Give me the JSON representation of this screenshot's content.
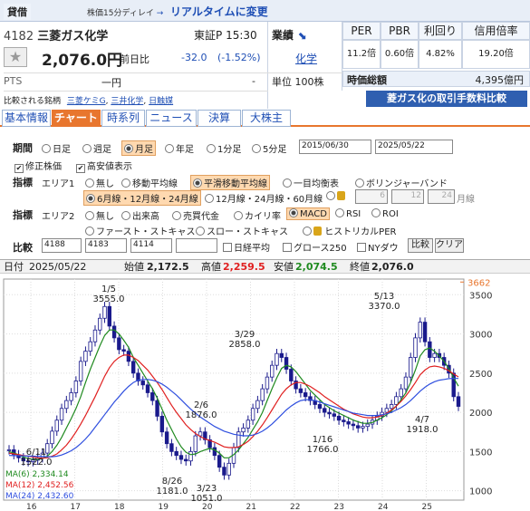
{
  "header": {
    "badge": "貸借",
    "delay": "株価15分ディレイ",
    "arrow": "→",
    "realtime": "リアルタイムに変更"
  },
  "quote": {
    "code": "4182",
    "name": "三菱ガス化学",
    "market": "東証P",
    "time": "15:30",
    "price": "2,076.0円",
    "prev_label": "前日比",
    "change": "-32.0",
    "change_pct": "(-1.52%)",
    "pts_label": "PTS",
    "pts_value": "一円",
    "pts_change": "-",
    "compare_label": "比較される銘柄",
    "compare_links": [
      "三菱ケミG",
      "三井化学",
      "日触媒"
    ]
  },
  "sector": {
    "label": "業績",
    "value": "化学",
    "unit": "単位 100株"
  },
  "stats": {
    "per_label": "PER",
    "pbr_label": "PBR",
    "yield_label": "利回り",
    "margin_label": "信用倍率",
    "per": "11.2倍",
    "pbr": "0.60倍",
    "yield": "4.82%",
    "margin": "19.20倍",
    "mcap_label": "時価総額",
    "mcap": "4,395億円",
    "promo": "菱ガス化の取引手数料比較"
  },
  "tabs": [
    "基本情報",
    "チャート",
    "時系列",
    "ニュース",
    "決算",
    "大株主"
  ],
  "controls": {
    "period_label": "期間",
    "periods": [
      "日足",
      "週足",
      "月足",
      "年足",
      "1分足",
      "5分足"
    ],
    "date_from": "2015/06/30",
    "date_to": "2025/05/22",
    "adjust": "修正株価",
    "highlow": "高安値表示",
    "ind_label": "指標",
    "area1": "エリア1",
    "area1_opts": [
      "無し",
      "移動平均線",
      "平滑移動平均線",
      "一目均衡表",
      "ボリンジャーバンド"
    ],
    "ma_opts": [
      "6月線・12月線・24月線",
      "12月線・24月線・60月線"
    ],
    "ma_inputs": [
      "6",
      "12",
      "24"
    ],
    "ma_unit": "月線",
    "area2": "エリア2",
    "area2_opts": [
      "無し",
      "出来高",
      "売買代金",
      "カイリ率",
      "MACD",
      "RSI",
      "ROI",
      "ファースト・ストキャス",
      "スロー・ストキャス",
      "ヒストリカルPER"
    ],
    "cmp_label": "比較",
    "cmp_inputs": [
      "4188",
      "4183",
      "4114",
      ""
    ],
    "cmp_opts": [
      "日経平均",
      "グロース250",
      "NYダウ"
    ],
    "cmp_btn": "比較",
    "clear_btn": "クリア"
  },
  "ohlc": {
    "date_label": "日付",
    "date": "2025/05/22",
    "open_label": "始値",
    "open": "2,172.5",
    "high_label": "高値",
    "high": "2,259.5",
    "low_label": "安値",
    "low": "2,074.5",
    "close_label": "終値",
    "close": "2,076.0"
  },
  "chart_data": {
    "type": "line",
    "y_ticks": [
      1000,
      1500,
      2000,
      2500,
      3000,
      3500
    ],
    "ylim": [
      880,
      3700
    ],
    "high_marker": "3662",
    "x_labels": [
      "16",
      "17",
      "18",
      "19",
      "20",
      "21",
      "22",
      "23",
      "24",
      "25"
    ],
    "ma_legend": [
      {
        "label": "MA(6)",
        "value": "2,334.14",
        "color": "#1f8a1f"
      },
      {
        "label": "MA(12)",
        "value": "2,452.56",
        "color": "#e02020"
      },
      {
        "label": "MA(24)",
        "value": "2,432.60",
        "color": "#2f4fdf"
      }
    ],
    "annotations": [
      {
        "date": "6/11",
        "value": "1522.0"
      },
      {
        "date": "1/5",
        "value": "3555.0"
      },
      {
        "date": "8/26",
        "value": "1181.0"
      },
      {
        "date": "2/6",
        "value": "1876.0"
      },
      {
        "date": "3/23",
        "value": "1051.0"
      },
      {
        "date": "3/29",
        "value": "2858.0"
      },
      {
        "date": "1/16",
        "value": "1766.0"
      },
      {
        "date": "5/13",
        "value": "3370.0"
      },
      {
        "date": "4/7",
        "value": "1918.0"
      }
    ],
    "closes": [
      1522,
      1460,
      1420,
      1380,
      1370,
      1390,
      1420,
      1480,
      1600,
      1760,
      1900,
      2050,
      2150,
      2250,
      2400,
      2650,
      2780,
      2900,
      3050,
      3200,
      3350,
      3100,
      2950,
      2800,
      2780,
      2650,
      2500,
      2400,
      2350,
      2250,
      2150,
      1950,
      1750,
      1600,
      1500,
      1450,
      1400,
      1380,
      1500,
      1700,
      1750,
      1650,
      1550,
      1450,
      1300,
      1200,
      1350,
      1550,
      1750,
      1800,
      1900,
      2050,
      2150,
      2300,
      2450,
      2600,
      2750,
      2700,
      2550,
      2400,
      2300,
      2250,
      2200,
      2150,
      2100,
      2050,
      2000,
      1980,
      1950,
      1900,
      1880,
      1850,
      1830,
      1800,
      1820,
      1850,
      1900,
      1950,
      2000,
      2050,
      2100,
      2200,
      2300,
      2450,
      2700,
      2950,
      3150,
      2900,
      2700,
      2750,
      2700,
      2600,
      2500,
      2200,
      2076
    ],
    "ma6": [
      1500,
      1480,
      1460,
      1430,
      1410,
      1400,
      1400,
      1410,
      1440,
      1500,
      1580,
      1680,
      1800,
      1920,
      2050,
      2200,
      2380,
      2550,
      2700,
      2850,
      2980,
      3050,
      3050,
      3000,
      2920,
      2830,
      2700,
      2600,
      2500,
      2400,
      2300,
      2180,
      2040,
      1900,
      1780,
      1660,
      1560,
      1490,
      1460,
      1470,
      1500,
      1520,
      1540,
      1520,
      1480,
      1420,
      1420,
      1460,
      1520,
      1600,
      1680,
      1780,
      1880,
      2000,
      2150,
      2300,
      2440,
      2560,
      2600,
      2580,
      2520,
      2440,
      2360,
      2280,
      2220,
      2160,
      2100,
      2060,
      2020,
      1990,
      1960,
      1930,
      1900,
      1880,
      1860,
      1860,
      1870,
      1900,
      1930,
      1970,
      2020,
      2080,
      2160,
      2250,
      2380,
      2540,
      2720,
      2800,
      2820,
      2780,
      2720,
      2650,
      2560,
      2440,
      2334
    ],
    "ma12": [
      1480,
      1470,
      1460,
      1450,
      1440,
      1430,
      1420,
      1415,
      1420,
      1440,
      1470,
      1520,
      1580,
      1660,
      1750,
      1850,
      1960,
      2080,
      2200,
      2330,
      2460,
      2570,
      2650,
      2700,
      2730,
      2730,
      2700,
      2660,
      2600,
      2540,
      2460,
      2380,
      2290,
      2190,
      2090,
      2000,
      1920,
      1840,
      1780,
      1730,
      1690,
      1660,
      1640,
      1620,
      1590,
      1560,
      1550,
      1550,
      1560,
      1590,
      1630,
      1690,
      1760,
      1840,
      1930,
      2030,
      2130,
      2230,
      2300,
      2350,
      2380,
      2380,
      2360,
      2330,
      2290,
      2250,
      2200,
      2160,
      2120,
      2080,
      2040,
      2010,
      1980,
      1960,
      1940,
      1930,
      1930,
      1940,
      1960,
      1990,
      2030,
      2080,
      2140,
      2210,
      2290,
      2380,
      2480,
      2540,
      2580,
      2590,
      2580,
      2560,
      2530,
      2490,
      2452
    ],
    "ma24": [
      1450,
      1448,
      1446,
      1444,
      1442,
      1440,
      1438,
      1436,
      1434,
      1434,
      1440,
      1455,
      1480,
      1510,
      1550,
      1600,
      1660,
      1730,
      1810,
      1890,
      1970,
      2050,
      2130,
      2200,
      2270,
      2330,
      2380,
      2410,
      2420,
      2420,
      2410,
      2390,
      2360,
      2320,
      2270,
      2220,
      2160,
      2100,
      2040,
      1990,
      1940,
      1900,
      1860,
      1820,
      1790,
      1760,
      1740,
      1720,
      1710,
      1700,
      1700,
      1710,
      1730,
      1760,
      1800,
      1850,
      1910,
      1970,
      2030,
      2080,
      2120,
      2150,
      2160,
      2160,
      2150,
      2130,
      2110,
      2090,
      2070,
      2050,
      2030,
      2010,
      1990,
      1980,
      1970,
      1960,
      1960,
      1960,
      1970,
      1980,
      2000,
      2030,
      2060,
      2100,
      2150,
      2210,
      2270,
      2320,
      2360,
      2390,
      2410,
      2420,
      2430,
      2432,
      2432
    ]
  }
}
